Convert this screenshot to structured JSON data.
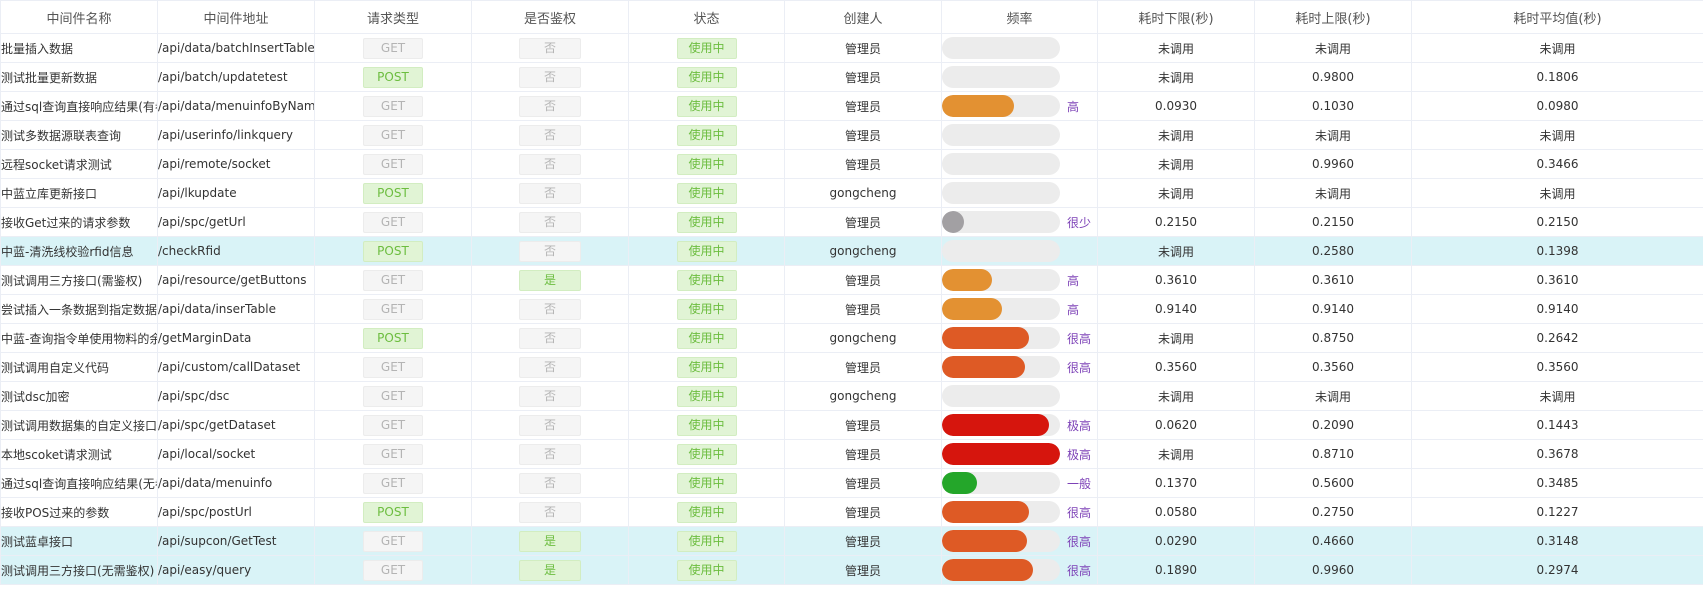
{
  "columns": [
    "中间件名称",
    "中间件地址",
    "请求类型",
    "是否鉴权",
    "状态",
    "创建人",
    "频率",
    "耗时下限(秒)",
    "耗时上限(秒)",
    "耗时平均值(秒)"
  ],
  "rows": [
    {
      "name": "批量插入数据",
      "addr": "/api/data/batchInsertTable",
      "method": "GET",
      "auth": "否",
      "status": "使用中",
      "creator": "管理员",
      "freq": 0.0,
      "freq_label": "",
      "freq_color": "#e8e8e8",
      "min": "未调用",
      "max": "未调用",
      "avg": "未调用",
      "hl": false
    },
    {
      "name": "测试批量更新数据",
      "addr": "/api/batch/updatetest",
      "method": "POST",
      "auth": "否",
      "status": "使用中",
      "creator": "管理员",
      "freq": 0.0,
      "freq_label": "",
      "freq_color": "#e8e8e8",
      "min": "未调用",
      "max": "0.9800",
      "avg": "0.1806",
      "hl": false
    },
    {
      "name": "通过sql查询直接响应结果(有参",
      "addr": "/api/data/menuinfoByName",
      "method": "GET",
      "auth": "否",
      "status": "使用中",
      "creator": "管理员",
      "freq": 0.61,
      "freq_label": "高",
      "freq_color": "#e39132",
      "min": "0.0930",
      "max": "0.1030",
      "avg": "0.0980",
      "hl": false
    },
    {
      "name": "测试多数据源联表查询",
      "addr": "/api/userinfo/linkquery",
      "method": "GET",
      "auth": "否",
      "status": "使用中",
      "creator": "管理员",
      "freq": 0.0,
      "freq_label": "",
      "freq_color": "#e8e8e8",
      "min": "未调用",
      "max": "未调用",
      "avg": "未调用",
      "hl": false
    },
    {
      "name": "远程socket请求测试",
      "addr": "/api/remote/socket",
      "method": "GET",
      "auth": "否",
      "status": "使用中",
      "creator": "管理员",
      "freq": 0.0,
      "freq_label": "",
      "freq_color": "#e8e8e8",
      "min": "未调用",
      "max": "0.9960",
      "avg": "0.3466",
      "hl": false
    },
    {
      "name": "中蓝立库更新接口",
      "addr": "/api/lkupdate",
      "method": "POST",
      "auth": "否",
      "status": "使用中",
      "creator": "gongcheng",
      "freq": 0.0,
      "freq_label": "",
      "freq_color": "#e8e8e8",
      "min": "未调用",
      "max": "未调用",
      "avg": "未调用",
      "hl": false
    },
    {
      "name": "接收Get过来的请求参数",
      "addr": "/api/spc/getUrl",
      "method": "GET",
      "auth": "否",
      "status": "使用中",
      "creator": "管理员",
      "freq": 0.19,
      "freq_label": "很少",
      "freq_color": "#a2a0a3",
      "min": "0.2150",
      "max": "0.2150",
      "avg": "0.2150",
      "hl": false
    },
    {
      "name": "中蓝-清洗线校验rfid信息",
      "addr": "/checkRfid",
      "method": "POST",
      "auth": "否",
      "status": "使用中",
      "creator": "gongcheng",
      "freq": 0.0,
      "freq_label": "",
      "freq_color": "#e8e8e8",
      "min": "未调用",
      "max": "0.2580",
      "avg": "0.1398",
      "hl": true
    },
    {
      "name": "测试调用三方接口(需鉴权)",
      "addr": "/api/resource/getButtons",
      "method": "GET",
      "auth": "是",
      "status": "使用中",
      "creator": "管理员",
      "freq": 0.42,
      "freq_label": "高",
      "freq_color": "#e39132",
      "min": "0.3610",
      "max": "0.3610",
      "avg": "0.3610",
      "hl": false
    },
    {
      "name": "尝试插入一条数据到指定数据/",
      "addr": "/api/data/inserTable",
      "method": "GET",
      "auth": "否",
      "status": "使用中",
      "creator": "管理员",
      "freq": 0.51,
      "freq_label": "高",
      "freq_color": "#e39132",
      "min": "0.9140",
      "max": "0.9140",
      "avg": "0.9140",
      "hl": false
    },
    {
      "name": "中蓝-查询指令单使用物料的余",
      "addr": "/getMarginData",
      "method": "POST",
      "auth": "否",
      "status": "使用中",
      "creator": "gongcheng",
      "freq": 0.74,
      "freq_label": "很高",
      "freq_color": "#de5a25",
      "min": "未调用",
      "max": "0.8750",
      "avg": "0.2642",
      "hl": false
    },
    {
      "name": "测试调用自定义代码",
      "addr": "/api/custom/callDataset",
      "method": "GET",
      "auth": "否",
      "status": "使用中",
      "creator": "管理员",
      "freq": 0.7,
      "freq_label": "很高",
      "freq_color": "#de5a25",
      "min": "0.3560",
      "max": "0.3560",
      "avg": "0.3560",
      "hl": false
    },
    {
      "name": "测试dsc加密",
      "addr": "/api/spc/dsc",
      "method": "GET",
      "auth": "否",
      "status": "使用中",
      "creator": "gongcheng",
      "freq": 0.0,
      "freq_label": "",
      "freq_color": "#e8e8e8",
      "min": "未调用",
      "max": "未调用",
      "avg": "未调用",
      "hl": false
    },
    {
      "name": "测试调用数据集的自定义接口",
      "addr": "/api/spc/getDataset",
      "method": "GET",
      "auth": "否",
      "status": "使用中",
      "creator": "管理员",
      "freq": 0.91,
      "freq_label": "极高",
      "freq_color": "#d6150d",
      "min": "0.0620",
      "max": "0.2090",
      "avg": "0.1443",
      "hl": false
    },
    {
      "name": "本地scoket请求测试",
      "addr": "/api/local/socket",
      "method": "GET",
      "auth": "否",
      "status": "使用中",
      "creator": "管理员",
      "freq": 1.0,
      "freq_label": "极高",
      "freq_color": "#d6150d",
      "min": "未调用",
      "max": "0.8710",
      "avg": "0.3678",
      "hl": false
    },
    {
      "name": "通过sql查询直接响应结果(无参",
      "addr": "/api/data/menuinfo",
      "method": "GET",
      "auth": "否",
      "status": "使用中",
      "creator": "管理员",
      "freq": 0.3,
      "freq_label": "一般",
      "freq_color": "#24a62a",
      "min": "0.1370",
      "max": "0.5600",
      "avg": "0.3485",
      "hl": false
    },
    {
      "name": "接收POS过来的参数",
      "addr": "/api/spc/postUrl",
      "method": "POST",
      "auth": "否",
      "status": "使用中",
      "creator": "管理员",
      "freq": 0.74,
      "freq_label": "很高",
      "freq_color": "#de5a25",
      "min": "0.0580",
      "max": "0.2750",
      "avg": "0.1227",
      "hl": false
    },
    {
      "name": "测试蓝卓接口",
      "addr": "/api/supcon/GetTest",
      "method": "GET",
      "auth": "是",
      "status": "使用中",
      "creator": "管理员",
      "freq": 0.72,
      "freq_label": "很高",
      "freq_color": "#de5a25",
      "min": "0.0290",
      "max": "0.4660",
      "avg": "0.3148",
      "hl": true
    },
    {
      "name": "测试调用三方接口(无需鉴权)",
      "addr": "/api/easy/query",
      "method": "GET",
      "auth": "是",
      "status": "使用中",
      "creator": "管理员",
      "freq": 0.77,
      "freq_label": "很高",
      "freq_color": "#de5a25",
      "min": "0.1890",
      "max": "0.9960",
      "avg": "0.2974",
      "hl": true
    }
  ]
}
